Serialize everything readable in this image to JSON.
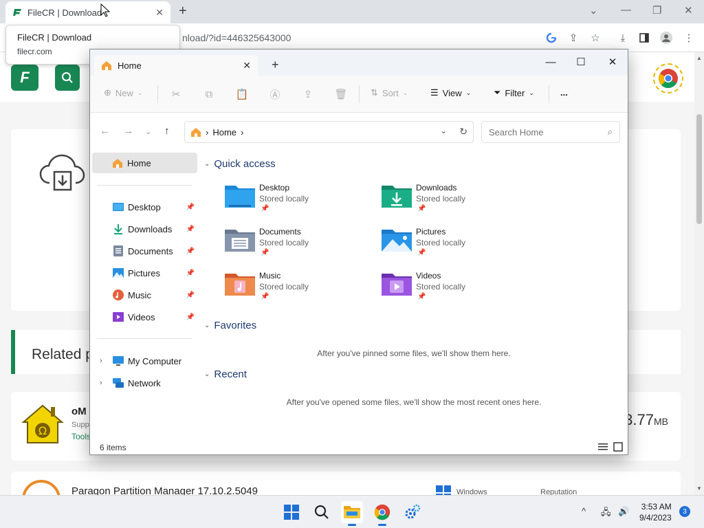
{
  "browser": {
    "tab_title": "FileCR | Download",
    "url": "nload/?id=446325643000",
    "tooltip_title": "FileCR | Download",
    "tooltip_url": "filecr.com"
  },
  "site": {
    "logo": "F",
    "related_title": "Related p",
    "product1": {
      "name": "oM",
      "sub": "Supp",
      "category": "Tools",
      "size": "3.77",
      "size_unit": "MB"
    },
    "product2": {
      "name": "Paragon Partition Manager 17.10.2.5049",
      "windows": "Windows",
      "reputation": "Reputation"
    }
  },
  "explorer": {
    "tab_label": "Home",
    "commands": {
      "new": "New",
      "sort": "Sort",
      "view": "View",
      "filter": "Filter",
      "more": "..."
    },
    "address": {
      "crumb": "Home"
    },
    "search_placeholder": "Search Home",
    "sidebar": {
      "home": "Home",
      "pinned": [
        {
          "label": "Desktop"
        },
        {
          "label": "Downloads"
        },
        {
          "label": "Documents"
        },
        {
          "label": "Pictures"
        },
        {
          "label": "Music"
        },
        {
          "label": "Videos"
        }
      ],
      "my_computer": "My Computer",
      "network": "Network"
    },
    "quick_access": {
      "header": "Quick access",
      "items": [
        {
          "name": "Desktop",
          "sub": "Stored locally"
        },
        {
          "name": "Downloads",
          "sub": "Stored locally"
        },
        {
          "name": "Documents",
          "sub": "Stored locally"
        },
        {
          "name": "Pictures",
          "sub": "Stored locally"
        },
        {
          "name": "Music",
          "sub": "Stored locally"
        },
        {
          "name": "Videos",
          "sub": "Stored locally"
        }
      ]
    },
    "favorites": {
      "header": "Favorites",
      "empty": "After you've pinned some files, we'll show them here."
    },
    "recent": {
      "header": "Recent",
      "empty": "After you've opened some files, we'll show the most recent ones here."
    },
    "status": {
      "count": "6 items"
    }
  },
  "taskbar": {
    "time": "3:53 AM",
    "date": "9/4/2023",
    "notifications": "3"
  },
  "colors": {
    "brand_green": "#198754",
    "accent_blue": "#1f6fd6",
    "section_header": "#1e3a6e"
  }
}
